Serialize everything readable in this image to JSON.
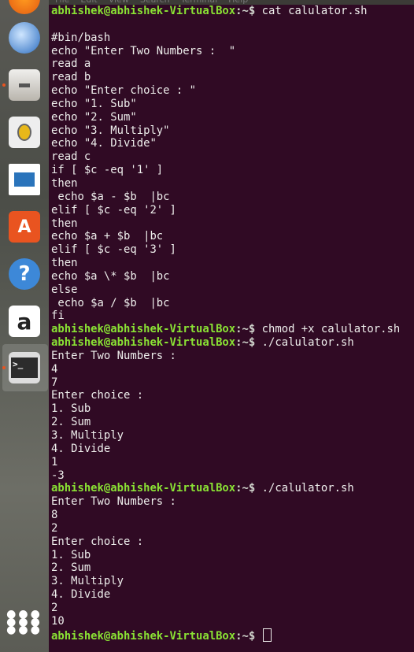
{
  "menubar": {
    "items": [
      "File",
      "Edit",
      "View",
      "Search",
      "Terminal",
      "Help"
    ]
  },
  "launcher": {
    "items": [
      "Firefox",
      "Thunderbird",
      "Files",
      "Rhythmbox",
      "LibreOffice Writer",
      "Ubuntu Software",
      "Help",
      "Amazon",
      "Terminal",
      "Show Applications"
    ]
  },
  "terminal": {
    "prompt_user": "abhishek@abhishek-VirtualBox",
    "prompt_sep": ":~$",
    "lines": [
      {
        "type": "prompt",
        "cmd": " cat calulator.sh"
      },
      {
        "type": "out",
        "text": ""
      },
      {
        "type": "out",
        "text": "#bin/bash"
      },
      {
        "type": "out",
        "text": "echo \"Enter Two Numbers :  \""
      },
      {
        "type": "out",
        "text": "read a"
      },
      {
        "type": "out",
        "text": "read b"
      },
      {
        "type": "out",
        "text": "echo \"Enter choice : \""
      },
      {
        "type": "out",
        "text": "echo \"1. Sub\""
      },
      {
        "type": "out",
        "text": "echo \"2. Sum\""
      },
      {
        "type": "out",
        "text": "echo \"3. Multiply\""
      },
      {
        "type": "out",
        "text": "echo \"4. Divide\""
      },
      {
        "type": "out",
        "text": "read c"
      },
      {
        "type": "out",
        "text": "if [ $c -eq '1' ]"
      },
      {
        "type": "out",
        "text": "then"
      },
      {
        "type": "out",
        "text": " echo $a - $b  |bc"
      },
      {
        "type": "out",
        "text": "elif [ $c -eq '2' ]"
      },
      {
        "type": "out",
        "text": "then"
      },
      {
        "type": "out",
        "text": "echo $a + $b  |bc"
      },
      {
        "type": "out",
        "text": "elif [ $c -eq '3' ]"
      },
      {
        "type": "out",
        "text": "then"
      },
      {
        "type": "out",
        "text": "echo $a \\* $b  |bc"
      },
      {
        "type": "out",
        "text": "else"
      },
      {
        "type": "out",
        "text": " echo $a / $b  |bc"
      },
      {
        "type": "out",
        "text": "fi"
      },
      {
        "type": "prompt",
        "cmd": " chmod +x calulator.sh"
      },
      {
        "type": "prompt",
        "cmd": " ./calulator.sh"
      },
      {
        "type": "out",
        "text": "Enter Two Numbers :"
      },
      {
        "type": "out",
        "text": "4"
      },
      {
        "type": "out",
        "text": "7"
      },
      {
        "type": "out",
        "text": "Enter choice :"
      },
      {
        "type": "out",
        "text": "1. Sub"
      },
      {
        "type": "out",
        "text": "2. Sum"
      },
      {
        "type": "out",
        "text": "3. Multiply"
      },
      {
        "type": "out",
        "text": "4. Divide"
      },
      {
        "type": "out",
        "text": "1"
      },
      {
        "type": "out",
        "text": "-3"
      },
      {
        "type": "prompt",
        "cmd": " ./calulator.sh"
      },
      {
        "type": "out",
        "text": "Enter Two Numbers :"
      },
      {
        "type": "out",
        "text": "8"
      },
      {
        "type": "out",
        "text": "2"
      },
      {
        "type": "out",
        "text": "Enter choice :"
      },
      {
        "type": "out",
        "text": "1. Sub"
      },
      {
        "type": "out",
        "text": "2. Sum"
      },
      {
        "type": "out",
        "text": "3. Multiply"
      },
      {
        "type": "out",
        "text": "4. Divide"
      },
      {
        "type": "out",
        "text": "2"
      },
      {
        "type": "out",
        "text": "10"
      },
      {
        "type": "prompt",
        "cmd": " ",
        "cursor": true
      }
    ]
  }
}
